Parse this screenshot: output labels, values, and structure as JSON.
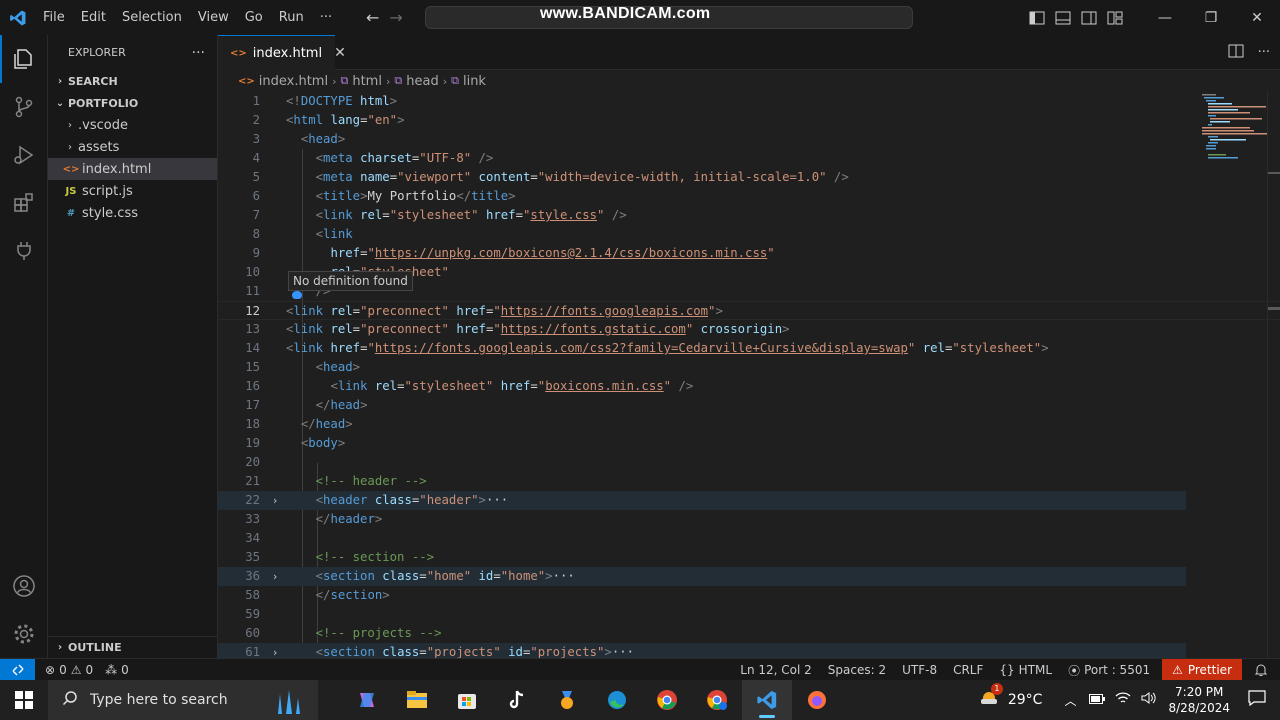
{
  "titlebar": {
    "menu": [
      "File",
      "Edit",
      "Selection",
      "View",
      "Go",
      "Run",
      "···"
    ],
    "watermark": "www.BANDICAM.com"
  },
  "sidebar": {
    "title": "EXPLORER",
    "more": "···",
    "search_section": "SEARCH",
    "project_section": "PORTFOLIO",
    "items": [
      {
        "label": ".vscode",
        "type": "folder"
      },
      {
        "label": "assets",
        "type": "folder"
      },
      {
        "label": "index.html",
        "type": "html"
      },
      {
        "label": "script.js",
        "type": "js"
      },
      {
        "label": "style.css",
        "type": "css"
      }
    ],
    "outline": "OUTLINE"
  },
  "tab": {
    "label": "index.html"
  },
  "breadcrumb": [
    "index.html",
    "html",
    "head",
    "link"
  ],
  "editor": {
    "tooltip": "No definition found",
    "lines": [
      {
        "n": "1",
        "code": "<!DOCTYPE html>"
      },
      {
        "n": "2",
        "code": "<html lang=\"en\">"
      },
      {
        "n": "3",
        "code": "  <head>"
      },
      {
        "n": "4",
        "code": "    <meta charset=\"UTF-8\" />"
      },
      {
        "n": "5",
        "code": "    <meta name=\"viewport\" content=\"width=device-width, initial-scale=1.0\" />"
      },
      {
        "n": "6",
        "code": "    <title>My Portfolio</title>"
      },
      {
        "n": "7",
        "code": "    <link rel=\"stylesheet\" href=\"style.css\" />"
      },
      {
        "n": "8",
        "code": "    <link"
      },
      {
        "n": "9",
        "code": "      href=\"https://unpkg.com/boxicons@2.1.4/css/boxicons.min.css\""
      },
      {
        "n": "10",
        "code": "      rel=\"stylesheet\""
      },
      {
        "n": "11",
        "code": "    />"
      },
      {
        "n": "12",
        "code": "<link rel=\"preconnect\" href=\"https://fonts.googleapis.com\">"
      },
      {
        "n": "13",
        "code": "<link rel=\"preconnect\" href=\"https://fonts.gstatic.com\" crossorigin>"
      },
      {
        "n": "14",
        "code": "<link href=\"https://fonts.googleapis.com/css2?family=Cedarville+Cursive&display=swap\" rel=\"stylesheet\">"
      },
      {
        "n": "15",
        "code": "    <head>"
      },
      {
        "n": "16",
        "code": "      <link rel=\"stylesheet\" href=\"boxicons.min.css\" />"
      },
      {
        "n": "17",
        "code": "    </head>"
      },
      {
        "n": "18",
        "code": "  </head>"
      },
      {
        "n": "19",
        "code": "  <body>"
      },
      {
        "n": "20",
        "code": ""
      },
      {
        "n": "21",
        "code": "    <!-- header -->"
      },
      {
        "n": "22",
        "code": "    <header class=\"header\">···"
      },
      {
        "n": "33",
        "code": "    </header>"
      },
      {
        "n": "34",
        "code": ""
      },
      {
        "n": "35",
        "code": "    <!-- section -->"
      },
      {
        "n": "36",
        "code": "    <section class=\"home\" id=\"home\">···"
      },
      {
        "n": "58",
        "code": "    </section>"
      },
      {
        "n": "59",
        "code": ""
      },
      {
        "n": "60",
        "code": "    <!-- projects -->"
      },
      {
        "n": "61",
        "code": "    <section class=\"projects\" id=\"projects\">···"
      }
    ]
  },
  "statusbar": {
    "problems": "0",
    "warnings": "0",
    "ports": "0",
    "position": "Ln 12, Col 2",
    "spaces": "Spaces: 2",
    "encoding": "UTF-8",
    "eol": "CRLF",
    "language": "HTML",
    "port": "Port : 5501",
    "prettier": "Prettier"
  },
  "taskbar": {
    "search_placeholder": "Type here to search",
    "temperature": "29°C",
    "time": "7:20 PM",
    "date": "8/28/2024",
    "weather_badge": "1"
  },
  "colors": {
    "accent": "#0078d4",
    "prettier_bg": "#c72e0f",
    "editor_bg": "#1f1f1f"
  }
}
